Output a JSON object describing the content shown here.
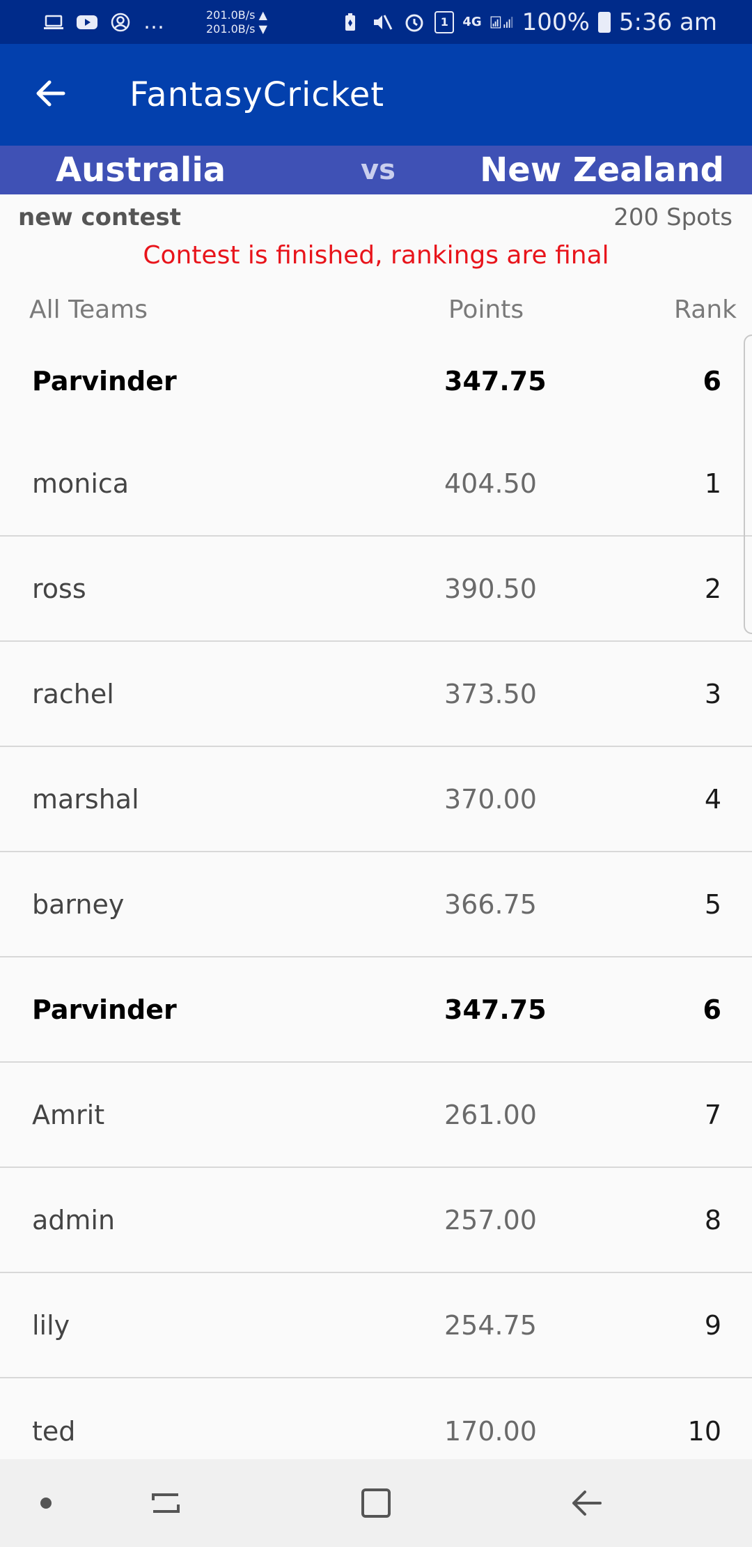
{
  "status_bar": {
    "speed_up": "201.0B/s ▲",
    "speed_down": "201.0B/s ▼",
    "sim_badge": "1",
    "network": "4G",
    "battery": "100%",
    "time": "5:36 am"
  },
  "app_bar": {
    "title": "FantasyCricket"
  },
  "match": {
    "team_a": "Australia",
    "vs": "vs",
    "team_b": "New Zealand"
  },
  "contest": {
    "name": "new contest",
    "spots": "200 Spots",
    "message": "Contest is finished, rankings are final",
    "message_color": "#e8141b"
  },
  "table": {
    "header_team": "All Teams",
    "header_points": "Points",
    "header_rank": "Rank",
    "my_team": {
      "name": "Parvinder",
      "points": "347.75",
      "rank": "6"
    },
    "rows": [
      {
        "name": "monica",
        "points": "404.50",
        "rank": "1"
      },
      {
        "name": "ross",
        "points": "390.50",
        "rank": "2"
      },
      {
        "name": "rachel",
        "points": "373.50",
        "rank": "3"
      },
      {
        "name": "marshal",
        "points": "370.00",
        "rank": "4"
      },
      {
        "name": "barney",
        "points": "366.75",
        "rank": "5"
      },
      {
        "name": "Parvinder",
        "points": "347.75",
        "rank": "6"
      },
      {
        "name": "Amrit",
        "points": "261.00",
        "rank": "7"
      },
      {
        "name": "admin",
        "points": "257.00",
        "rank": "8"
      },
      {
        "name": "lily",
        "points": "254.75",
        "rank": "9"
      },
      {
        "name": "ted",
        "points": "170.00",
        "rank": "10"
      }
    ]
  },
  "colors": {
    "status_bar": "#002b8a",
    "app_bar": "#0340ad",
    "match_bar": "#3f51b5"
  },
  "icons": {
    "back": "arrow-left-icon",
    "nav_recent": "recent-apps-icon",
    "nav_home": "home-icon",
    "nav_back": "nav-back-icon"
  }
}
